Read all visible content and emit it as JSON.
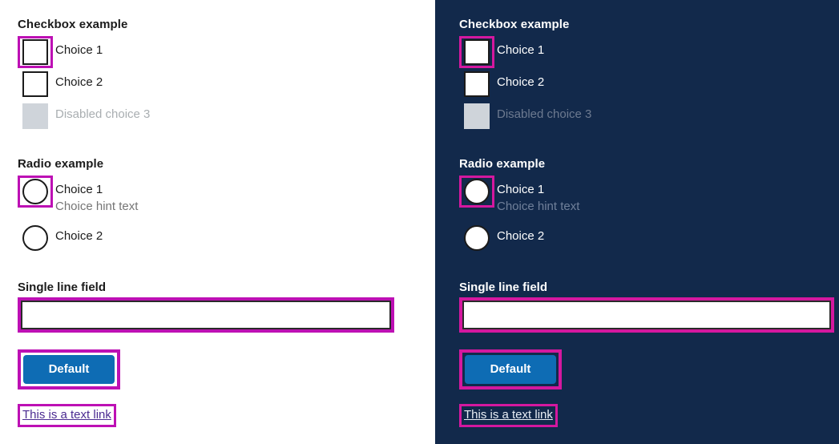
{
  "panels": [
    {
      "theme": "light",
      "background": "#ffffff",
      "checkbox_group": {
        "heading": "Checkbox example",
        "options": [
          {
            "label": "Choice 1",
            "focused": true,
            "disabled": false,
            "hint": ""
          },
          {
            "label": "Choice 2",
            "focused": false,
            "disabled": false,
            "hint": ""
          },
          {
            "label": "Disabled choice 3",
            "focused": false,
            "disabled": true,
            "hint": ""
          }
        ]
      },
      "radio_group": {
        "heading": "Radio example",
        "options": [
          {
            "label": "Choice 1",
            "focused": true,
            "disabled": false,
            "hint": "Choice hint text"
          },
          {
            "label": "Choice 2",
            "focused": false,
            "disabled": false,
            "hint": ""
          }
        ]
      },
      "field": {
        "label": "Single line field",
        "value": "",
        "placeholder": ""
      },
      "button": {
        "label": "Default"
      },
      "link": {
        "label": "This is a text link"
      }
    },
    {
      "theme": "dark",
      "background": "#12294b",
      "checkbox_group": {
        "heading": "Checkbox example",
        "options": [
          {
            "label": "Choice 1",
            "focused": true,
            "disabled": false,
            "hint": ""
          },
          {
            "label": "Choice 2",
            "focused": false,
            "disabled": false,
            "hint": ""
          },
          {
            "label": "Disabled choice 3",
            "focused": false,
            "disabled": true,
            "hint": ""
          }
        ]
      },
      "radio_group": {
        "heading": "Radio example",
        "options": [
          {
            "label": "Choice 1",
            "focused": true,
            "disabled": false,
            "hint": "Choice hint text"
          },
          {
            "label": "Choice 2",
            "focused": false,
            "disabled": false,
            "hint": ""
          }
        ]
      },
      "field": {
        "label": "Single line field",
        "value": "",
        "placeholder": ""
      },
      "button": {
        "label": "Default"
      },
      "link": {
        "label": "This is a text link"
      }
    }
  ],
  "colors": {
    "focus_ring_light": "#bd10b4",
    "focus_ring_dark": "#d4189f",
    "button_blue": "#0e6cb4",
    "link_purple": "#4c2c92",
    "link_light": "#e8eef5",
    "dark_panel": "#12294b",
    "disabled_gray": "#cfd4da",
    "hint_gray": "#757575"
  }
}
